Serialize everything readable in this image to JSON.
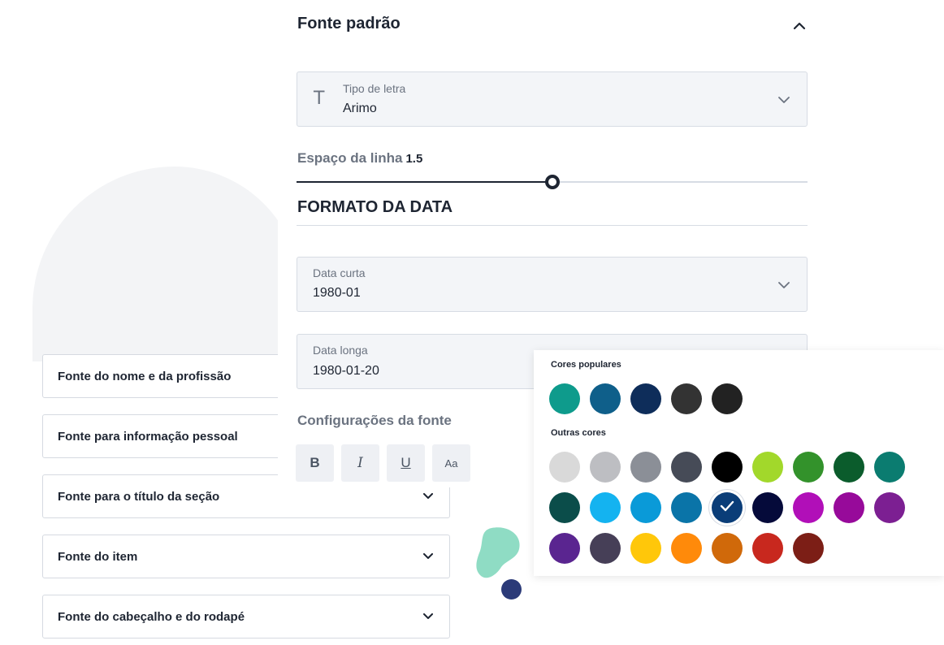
{
  "left_list": {
    "items": [
      {
        "label": "Fonte do nome e da profissão",
        "chevron": false
      },
      {
        "label": "Fonte para informação pessoal",
        "chevron": false
      },
      {
        "label": "Fonte para o título da seção",
        "chevron": true
      },
      {
        "label": "Fonte do item",
        "chevron": true
      },
      {
        "label": "Fonte do cabeçalho e do rodapé",
        "chevron": true
      }
    ]
  },
  "panel": {
    "title": "Fonte padrão",
    "collapse_icon": "chevron-up-icon",
    "font_type": {
      "label": "Tipo de letra",
      "value": "Arimo",
      "icon": "T"
    },
    "line_spacing": {
      "label": "Espaço da linha",
      "value": "1.5",
      "fraction": 0.5
    },
    "date_format": {
      "heading": "FORMATO DA DATA",
      "short": {
        "label": "Data curta",
        "value": "1980-01"
      },
      "long": {
        "label": "Data longa",
        "value": "1980-01-20"
      }
    },
    "font_settings": {
      "label": "Configurações da fonte",
      "buttons": [
        {
          "name": "bold-button",
          "glyph": "B"
        },
        {
          "name": "italic-button",
          "glyph": "I"
        },
        {
          "name": "underline-button",
          "glyph": "U"
        },
        {
          "name": "font-case-button",
          "glyph": "Aa"
        }
      ]
    }
  },
  "color_picker": {
    "popular_title": "Cores populares",
    "popular": [
      "#0e9b8c",
      "#0f5f8a",
      "#0e2d5a",
      "#333333",
      "#222222"
    ],
    "other_title": "Outras cores",
    "other": [
      "#d9d9d9",
      "#bdbec2",
      "#8b8f97",
      "#464b57",
      "#000000",
      "#a2d82b",
      "#33922b",
      "#0b5c2c",
      "#0b7c70",
      "#0b4d4a",
      "#14b3f0",
      "#0a9ad8",
      "#0a74a8",
      "#0a3d78",
      "#050a3a",
      "#b10fb8",
      "#970a9a",
      "#7c1f92",
      "#5a2590",
      "#463f57",
      "#ffc70a",
      "#ff8a0a",
      "#d0690a",
      "#c8281e",
      "#7c1e16"
    ],
    "selected_index": 13
  }
}
